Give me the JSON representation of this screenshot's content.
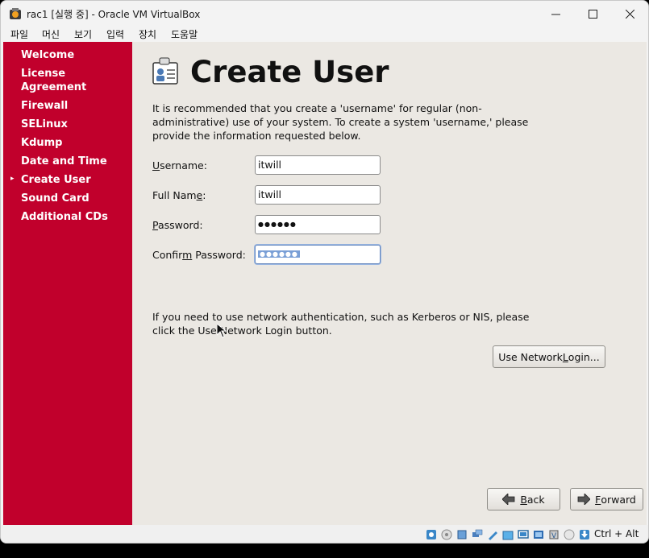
{
  "window": {
    "title": "rac1 [실행 중] - Oracle VM VirtualBox",
    "controls": {
      "minimize": "—",
      "maximize": "☐",
      "close": "✕"
    }
  },
  "menu": [
    "파일",
    "머신",
    "보기",
    "입력",
    "장치",
    "도움말"
  ],
  "sidebar": {
    "items": [
      {
        "label": "Welcome"
      },
      {
        "label": "License\nAgreement"
      },
      {
        "label": "Firewall"
      },
      {
        "label": "SELinux"
      },
      {
        "label": "Kdump"
      },
      {
        "label": "Date and Time"
      },
      {
        "label": "Create User",
        "current": true
      },
      {
        "label": "Sound Card"
      },
      {
        "label": "Additional CDs"
      }
    ],
    "current_marker": "▸"
  },
  "page": {
    "title": "Create User",
    "intro": "It is recommended that you create a 'username' for regular (non-administrative) use of your system. To create a system 'username,' please provide the information requested below.",
    "fields": {
      "username": {
        "label_pre": "",
        "mnemonic": "U",
        "label_post": "sername:",
        "value": "itwill"
      },
      "fullname": {
        "label_pre": "Full Nam",
        "mnemonic": "e",
        "label_post": ":",
        "value": "itwill"
      },
      "password": {
        "label_pre": "",
        "mnemonic": "P",
        "label_post": "assword:",
        "value": "●●●●●●"
      },
      "confirm": {
        "label_pre": "Confir",
        "mnemonic": "m",
        "label_post": " Password:",
        "value": "●●●●●●"
      }
    },
    "network_note": "If you need to use network authentication, such as Kerberos or NIS, please click the Use Network Login button.",
    "network_button": {
      "pre": "Use Network ",
      "mnemonic": "L",
      "post": "ogin..."
    },
    "back_button": {
      "mnemonic": "B",
      "post": "ack"
    },
    "forward_button": {
      "mnemonic": "F",
      "post": "orward"
    }
  },
  "statusbar": {
    "host_key": "Ctrl + Alt"
  },
  "colors": {
    "sidebar": "#c1002c",
    "background": "#ebe8e3",
    "selection": "#7a9fd6"
  }
}
